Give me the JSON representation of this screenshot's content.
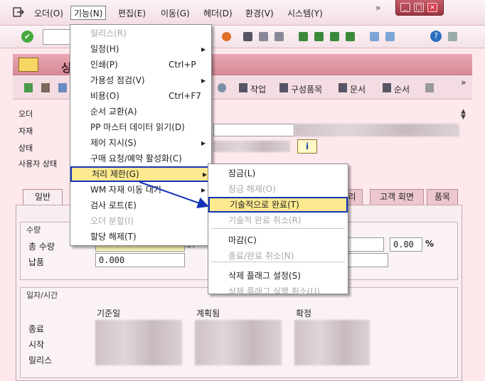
{
  "menubar": {
    "items": [
      "오더(O)",
      "기능(N)",
      "편집(E)",
      "이동(G)",
      "헤더(D)",
      "환경(V)",
      "시스템(Y)"
    ],
    "overflow": "»"
  },
  "window_buttons": {
    "minimize": "_",
    "maximize": "□",
    "close": "×"
  },
  "toolbar": {
    "check": "✔",
    "help": "?"
  },
  "title_band": {
    "title": "싱"
  },
  "app_toolbar": {
    "work_label": "작업",
    "components_label": "구성품목",
    "documents_label": "문서",
    "sequence_label": "순서",
    "overflow": "»"
  },
  "form": {
    "labels": [
      "오더",
      "자재",
      "상태",
      "사용자 상태"
    ],
    "info_button": "i"
  },
  "tabs": [
    {
      "label": "일반"
    },
    {
      "label": "리"
    },
    {
      "label": "고객 회면"
    },
    {
      "label": "품목"
    }
  ],
  "quantity_group": {
    "title": "수량",
    "total_label": "총 수량",
    "delivered_label": "납품",
    "delivered_value": "0.000",
    "unit_fragment": "ST",
    "percent_value": "0.00",
    "percent_sign": "%"
  },
  "dates_group": {
    "title": "일자/시간",
    "col_headers": [
      "기준일",
      "계획됨",
      "확정"
    ],
    "row_labels": [
      "종료",
      "시작",
      "릴리스"
    ]
  },
  "function_menu": {
    "items": [
      {
        "label": "릴리스(R)",
        "shortcut": "",
        "submenu": false,
        "disabled": true
      },
      {
        "label": "일정(H)",
        "shortcut": "",
        "submenu": true,
        "disabled": false
      },
      {
        "label": "인쇄(P)",
        "shortcut": "Ctrl+P",
        "submenu": false,
        "disabled": false
      },
      {
        "label": "가용성 점검(V)",
        "shortcut": "",
        "submenu": true,
        "disabled": false
      },
      {
        "label": "비용(O)",
        "shortcut": "Ctrl+F7",
        "submenu": false,
        "disabled": false
      },
      {
        "label": "순서 교환(A)",
        "shortcut": "",
        "submenu": false,
        "disabled": false
      },
      {
        "label": "PP 마스터 데이터 읽기(D)",
        "shortcut": "",
        "submenu": false,
        "disabled": false
      },
      {
        "label": "제어 지시(S)",
        "shortcut": "",
        "submenu": true,
        "disabled": false
      },
      {
        "label": "구매 요청/예약 활성화(C)",
        "shortcut": "",
        "submenu": false,
        "disabled": false
      },
      {
        "label": "처리 제한(G)",
        "shortcut": "",
        "submenu": true,
        "disabled": false,
        "highlighted": true
      },
      {
        "label": "WM 자재 이동 대기",
        "shortcut": "",
        "submenu": true,
        "disabled": false
      },
      {
        "label": "검사 로트(E)",
        "shortcut": "",
        "submenu": false,
        "disabled": false
      },
      {
        "label": "오더 분할(I)",
        "shortcut": "",
        "submenu": false,
        "disabled": true
      },
      {
        "label": "할당 해제(T)",
        "shortcut": "",
        "submenu": false,
        "disabled": false
      }
    ]
  },
  "restriction_submenu": {
    "items": [
      {
        "label": "잠금(L)",
        "disabled": false
      },
      {
        "label": "잠금 해제(O)",
        "disabled": true
      },
      {
        "label": "기술적으로 완료(T)",
        "disabled": false,
        "highlighted": true
      },
      {
        "label": "기술적 완료 취소(R)",
        "disabled": true
      },
      {
        "label": "마감(C)",
        "disabled": false
      },
      {
        "label": "종료/완료 취소(N)",
        "disabled": true
      },
      {
        "label": "삭제 플래그 설정(S)",
        "disabled": false
      },
      {
        "label": "삭제 플래그 실행 취소(U)",
        "disabled": true
      }
    ]
  },
  "colors": {
    "highlight": "#fde98f",
    "annotation_border": "#1433b8",
    "band": "#d88a97"
  }
}
